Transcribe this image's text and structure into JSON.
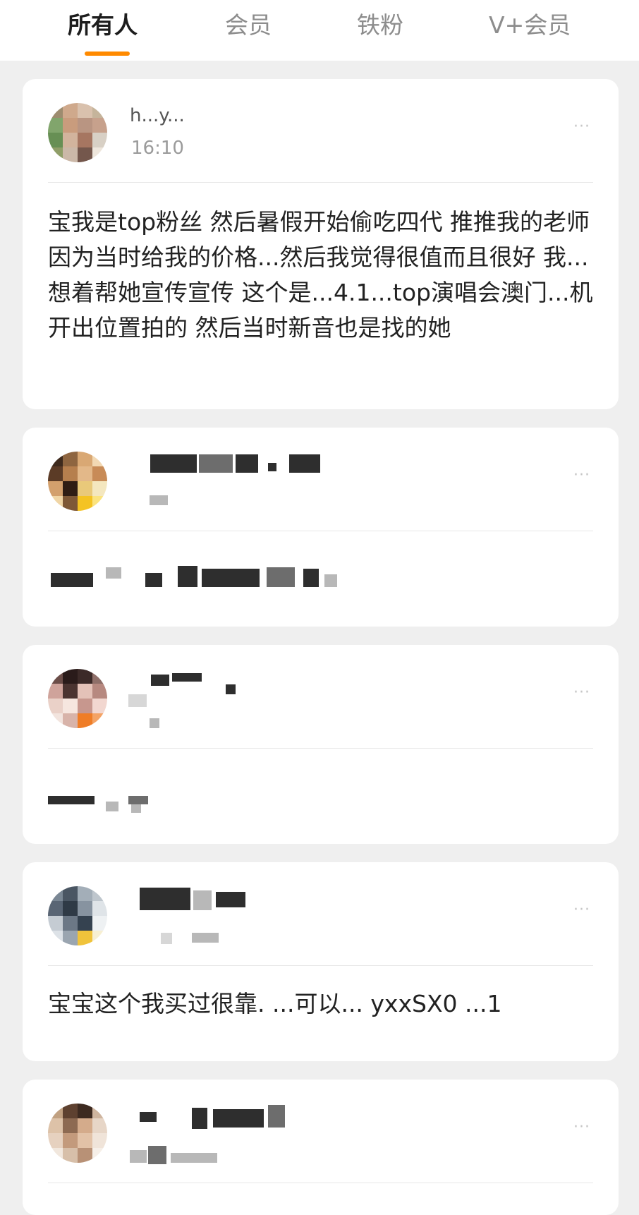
{
  "tabs": [
    {
      "label": "所有人",
      "active": true
    },
    {
      "label": "会员",
      "active": false
    },
    {
      "label": "铁粉",
      "active": false
    },
    {
      "label": "V+会员",
      "active": false
    }
  ],
  "colors": {
    "accent": "#ff8a00",
    "background": "#efefef",
    "card": "#ffffff",
    "text_primary": "#222222",
    "text_secondary": "#9b9b9b"
  },
  "comments": [
    {
      "username": "h...y...",
      "time": "16:10",
      "text": "宝我是top粉丝 然后暑假开始偷吃四代 推推我的老师 因为当时给我的价格...然后我觉得很值而且很好 我...想着帮她宣传宣传 这个是...4.1...top演唱会澳门...机开出位置拍的 然后当时新音也是找的她",
      "more_icon": "more-dots-icon"
    },
    {
      "username": "",
      "time": "",
      "text": "",
      "more_icon": "more-dots-icon"
    },
    {
      "username": "",
      "time": "",
      "text": "",
      "more_icon": "more-dots-icon"
    },
    {
      "username": "",
      "time": "",
      "text": "宝宝这个我买过很靠. ...可以... yxxSX0 ...1",
      "more_icon": "more-dots-icon"
    },
    {
      "username": "",
      "time": "",
      "text": "",
      "more_icon": "more-dots-icon"
    }
  ]
}
